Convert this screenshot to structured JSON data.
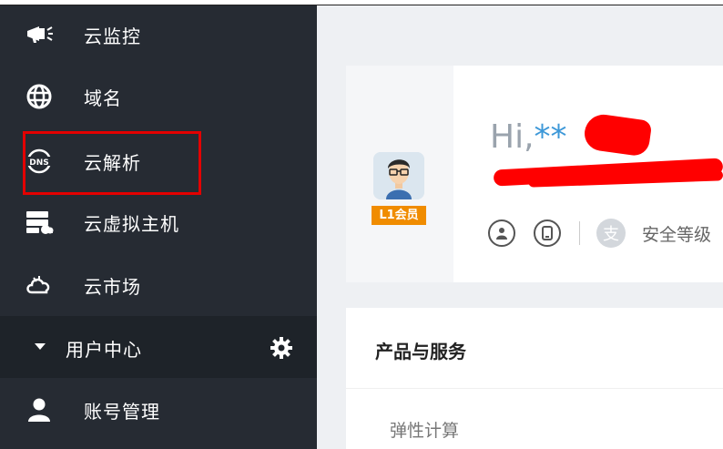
{
  "sidebar": {
    "items": [
      {
        "label": "云监控",
        "icon": "megaphone-icon"
      },
      {
        "label": "域名",
        "icon": "globe-icon"
      },
      {
        "label": "云解析",
        "icon": "dns-icon"
      },
      {
        "label": "云虚拟主机",
        "icon": "server-icon"
      },
      {
        "label": "云市场",
        "icon": "cloud-market-icon"
      }
    ],
    "section": {
      "label": "用户中心",
      "icon": "gear-icon"
    },
    "section_items": [
      {
        "label": "账号管理",
        "icon": "user-icon"
      }
    ]
  },
  "profile": {
    "greeting_prefix": "Hi,",
    "greeting_masked": "**",
    "member_badge": "L1会员",
    "security_label": "安全等级",
    "security_icon_char": "支"
  },
  "products": {
    "title": "产品与服务",
    "category": "弹性计算"
  },
  "colors": {
    "sidebar_bg": "#262b33",
    "section_bg": "#1e2329",
    "highlight": "#e30000",
    "badge": "#f08c00",
    "link_blue": "#3d98d8"
  }
}
